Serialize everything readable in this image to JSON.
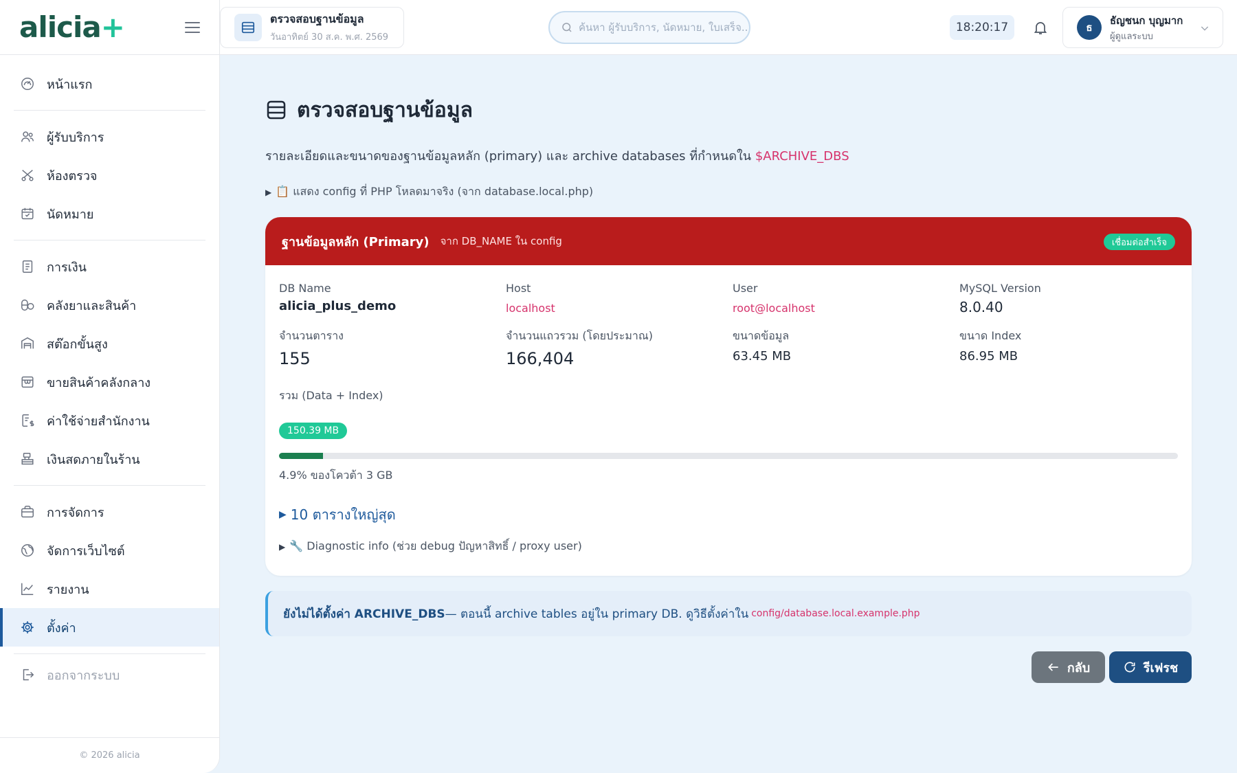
{
  "brand": {
    "name": "alicia",
    "plus": "+"
  },
  "sidebar": {
    "items": [
      {
        "label": "หน้าแรก",
        "icon": "dashboard-icon"
      },
      {
        "label": "ผู้รับบริการ",
        "icon": "users-icon"
      },
      {
        "label": "ห้องตรวจ",
        "icon": "scissors-icon"
      },
      {
        "label": "นัดหมาย",
        "icon": "calendar-icon"
      },
      {
        "label": "การเงิน",
        "icon": "receipt-icon"
      },
      {
        "label": "คลังยาและสินค้า",
        "icon": "pills-icon"
      },
      {
        "label": "สต๊อกขั้นสูง",
        "icon": "warehouse-icon"
      },
      {
        "label": "ขายสินค้าคลังกลาง",
        "icon": "store-icon"
      },
      {
        "label": "ค่าใช้จ่ายสำนักงาน",
        "icon": "expense-icon"
      },
      {
        "label": "เงินสดภายในร้าน",
        "icon": "cash-register-icon"
      },
      {
        "label": "การจัดการ",
        "icon": "briefcase-icon"
      },
      {
        "label": "จัดการเว็บไซต์",
        "icon": "globe-icon"
      },
      {
        "label": "รายงาน",
        "icon": "chart-line-icon"
      },
      {
        "label": "ตั้งค่า",
        "icon": "gear-icon",
        "active": true
      },
      {
        "label": "ออกจากระบบ",
        "icon": "logout-icon"
      }
    ],
    "footer": "© 2026 alicia"
  },
  "header": {
    "page_title": "ตรวจสอบฐานข้อมูล",
    "page_date": "วันอาทิตย์ 30 ส.ค. พ.ศ. 2569",
    "search_placeholder": "ค้นหา ผู้รับบริการ, นัดหมาย, ใบเสร็จ...",
    "clock": "18:20:17",
    "user_initial": "ธ",
    "user_name": "ธัญชนก บุญมาก",
    "user_role": "ผู้ดูแลระบบ"
  },
  "main": {
    "title": "ตรวจสอบฐานข้อมูล",
    "desc_prefix": "รายละเอียดและขนาดของฐานข้อมูลหลัก (primary) และ archive databases ที่กำหนดใน ",
    "desc_var": "$ARCHIVE_DBS",
    "config_toggle": "📋 แสดง config ที่ PHP โหลดมาจริง (จาก database.local.php)",
    "card": {
      "title": "ฐานข้อมูลหลัก (Primary)",
      "subtitle": "จาก DB_NAME ใน config",
      "status": "เชื่อมต่อสำเร็จ",
      "fields": {
        "db_name_label": "DB Name",
        "db_name": "alicia_plus_demo",
        "host_label": "Host",
        "host": "localhost",
        "user_label": "User",
        "user": "root@localhost",
        "mysql_label": "MySQL Version",
        "mysql": "8.0.40",
        "tables_label": "จำนวนตาราง",
        "tables": "155",
        "rows_label": "จำนวนแถวรวม (โดยประมาณ)",
        "rows": "166,404",
        "data_size_label": "ขนาดข้อมูล",
        "data_size": "63.45 MB",
        "index_size_label": "ขนาด Index",
        "index_size": "86.95 MB"
      },
      "total_label": "รวม (Data + Index)",
      "total": "150.39 MB",
      "quota_percent": 4.9,
      "quota_text": "4.9% ของโควต้า 3 GB",
      "largest_tables": "10 ตารางใหญ่สุด",
      "diagnostic": "🔧 Diagnostic info (ช่วย debug ปัญหาสิทธิ์ / proxy user)"
    },
    "alert": {
      "bold": "ยังไม่ได้ตั้งค่า ARCHIVE_DBS",
      "text": " — ตอนนี้ archive tables อยู่ใน primary DB. ดูวิธีตั้งค่าใน",
      "path": "config/database.local.example.php"
    },
    "buttons": {
      "back": "กลับ",
      "refresh": "รีเฟรช"
    }
  },
  "colors": {
    "primary": "#1e4f82",
    "danger": "#b91c1c",
    "success": "#20c997",
    "accent_pink": "#d6336c"
  }
}
